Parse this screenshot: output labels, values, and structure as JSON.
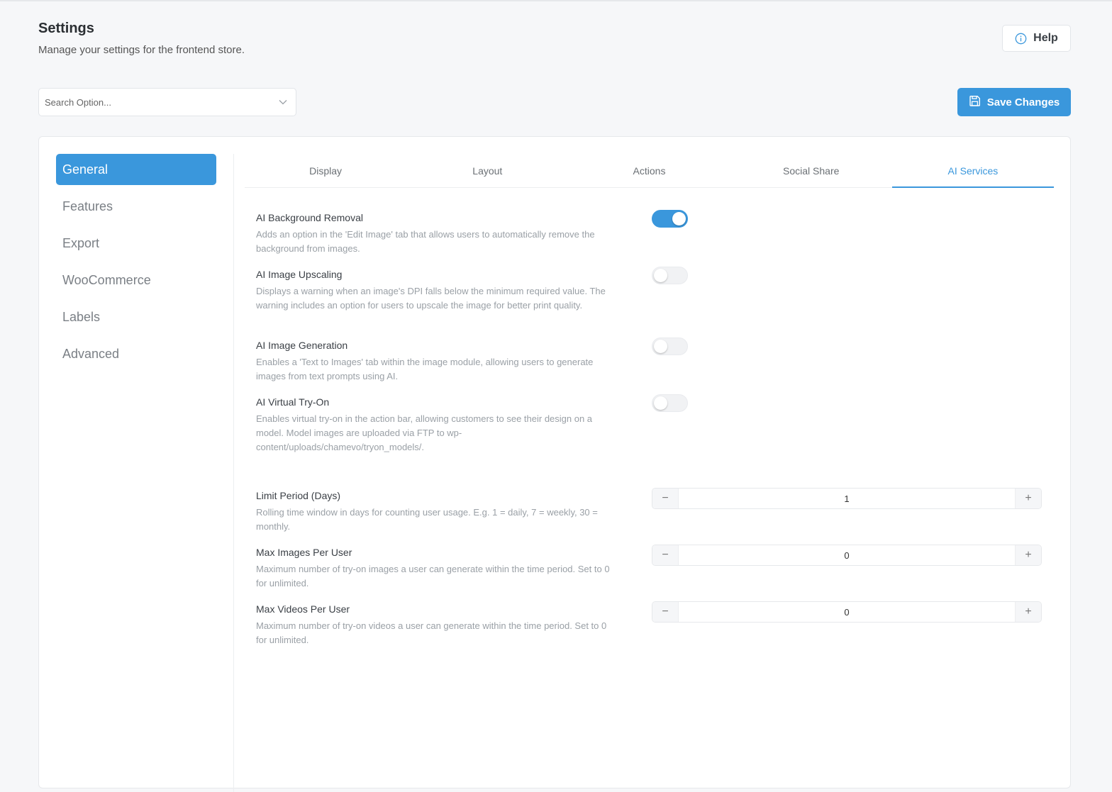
{
  "header": {
    "title": "Settings",
    "subtitle": "Manage your settings for the frontend store.",
    "help_label": "Help"
  },
  "search": {
    "placeholder": "Search Option..."
  },
  "toolbar": {
    "save_label": "Save Changes"
  },
  "colors": {
    "accent": "#3a97dc"
  },
  "sidebar": {
    "items": [
      {
        "label": "General",
        "active": true
      },
      {
        "label": "Features"
      },
      {
        "label": "Export"
      },
      {
        "label": "WooCommerce"
      },
      {
        "label": "Labels"
      },
      {
        "label": "Advanced"
      }
    ]
  },
  "tabs": [
    {
      "label": "Display"
    },
    {
      "label": "Layout"
    },
    {
      "label": "Actions"
    },
    {
      "label": "Social Share"
    },
    {
      "label": "AI Services",
      "active": true
    }
  ],
  "settings": {
    "bg_removal": {
      "label": "AI Background Removal",
      "desc": "Adds an option in the 'Edit Image' tab that allows users to automatically remove the background from images.",
      "enabled": true
    },
    "upscaling": {
      "label": "AI Image Upscaling",
      "desc": "Displays a warning when an image's DPI falls below the minimum required value. The warning includes an option for users to upscale the image for better print quality.",
      "enabled": false
    },
    "generation": {
      "label": "AI Image Generation",
      "desc": "Enables a 'Text to Images' tab within the image module, allowing users to generate images from text prompts using AI.",
      "enabled": false
    },
    "tryon": {
      "label": "AI Virtual Try-On",
      "desc": "Enables virtual try-on in the action bar, allowing customers to see their design on a model. Model images are uploaded via FTP to wp-content/uploads/chamevo/tryon_models/.",
      "enabled": false
    },
    "limit_period": {
      "label": "Limit Period (Days)",
      "desc": "Rolling time window in days for counting user usage. E.g. 1 = daily, 7 = weekly, 30 = monthly.",
      "value": "1"
    },
    "max_images": {
      "label": "Max Images Per User",
      "desc": "Maximum number of try-on images a user can generate within the time period. Set to 0 for unlimited.",
      "value": "0"
    },
    "max_videos": {
      "label": "Max Videos Per User",
      "desc": "Maximum number of try-on videos a user can generate within the time period. Set to 0 for unlimited.",
      "value": "0"
    }
  },
  "stepper": {
    "minus": "−",
    "plus": "+"
  }
}
